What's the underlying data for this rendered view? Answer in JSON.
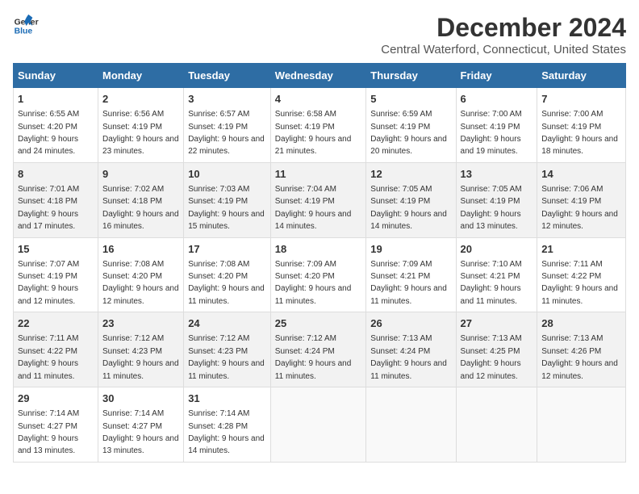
{
  "logo": {
    "line1": "General",
    "line2": "Blue"
  },
  "title": "December 2024",
  "subtitle": "Central Waterford, Connecticut, United States",
  "days_of_week": [
    "Sunday",
    "Monday",
    "Tuesday",
    "Wednesday",
    "Thursday",
    "Friday",
    "Saturday"
  ],
  "weeks": [
    [
      {
        "day": 1,
        "rise": "6:55 AM",
        "set": "4:20 PM",
        "daylight": "9 hours and 24 minutes."
      },
      {
        "day": 2,
        "rise": "6:56 AM",
        "set": "4:19 PM",
        "daylight": "9 hours and 23 minutes."
      },
      {
        "day": 3,
        "rise": "6:57 AM",
        "set": "4:19 PM",
        "daylight": "9 hours and 22 minutes."
      },
      {
        "day": 4,
        "rise": "6:58 AM",
        "set": "4:19 PM",
        "daylight": "9 hours and 21 minutes."
      },
      {
        "day": 5,
        "rise": "6:59 AM",
        "set": "4:19 PM",
        "daylight": "9 hours and 20 minutes."
      },
      {
        "day": 6,
        "rise": "7:00 AM",
        "set": "4:19 PM",
        "daylight": "9 hours and 19 minutes."
      },
      {
        "day": 7,
        "rise": "7:00 AM",
        "set": "4:19 PM",
        "daylight": "9 hours and 18 minutes."
      }
    ],
    [
      {
        "day": 8,
        "rise": "7:01 AM",
        "set": "4:18 PM",
        "daylight": "9 hours and 17 minutes."
      },
      {
        "day": 9,
        "rise": "7:02 AM",
        "set": "4:18 PM",
        "daylight": "9 hours and 16 minutes."
      },
      {
        "day": 10,
        "rise": "7:03 AM",
        "set": "4:19 PM",
        "daylight": "9 hours and 15 minutes."
      },
      {
        "day": 11,
        "rise": "7:04 AM",
        "set": "4:19 PM",
        "daylight": "9 hours and 14 minutes."
      },
      {
        "day": 12,
        "rise": "7:05 AM",
        "set": "4:19 PM",
        "daylight": "9 hours and 14 minutes."
      },
      {
        "day": 13,
        "rise": "7:05 AM",
        "set": "4:19 PM",
        "daylight": "9 hours and 13 minutes."
      },
      {
        "day": 14,
        "rise": "7:06 AM",
        "set": "4:19 PM",
        "daylight": "9 hours and 12 minutes."
      }
    ],
    [
      {
        "day": 15,
        "rise": "7:07 AM",
        "set": "4:19 PM",
        "daylight": "9 hours and 12 minutes."
      },
      {
        "day": 16,
        "rise": "7:08 AM",
        "set": "4:20 PM",
        "daylight": "9 hours and 12 minutes."
      },
      {
        "day": 17,
        "rise": "7:08 AM",
        "set": "4:20 PM",
        "daylight": "9 hours and 11 minutes."
      },
      {
        "day": 18,
        "rise": "7:09 AM",
        "set": "4:20 PM",
        "daylight": "9 hours and 11 minutes."
      },
      {
        "day": 19,
        "rise": "7:09 AM",
        "set": "4:21 PM",
        "daylight": "9 hours and 11 minutes."
      },
      {
        "day": 20,
        "rise": "7:10 AM",
        "set": "4:21 PM",
        "daylight": "9 hours and 11 minutes."
      },
      {
        "day": 21,
        "rise": "7:11 AM",
        "set": "4:22 PM",
        "daylight": "9 hours and 11 minutes."
      }
    ],
    [
      {
        "day": 22,
        "rise": "7:11 AM",
        "set": "4:22 PM",
        "daylight": "9 hours and 11 minutes."
      },
      {
        "day": 23,
        "rise": "7:12 AM",
        "set": "4:23 PM",
        "daylight": "9 hours and 11 minutes."
      },
      {
        "day": 24,
        "rise": "7:12 AM",
        "set": "4:23 PM",
        "daylight": "9 hours and 11 minutes."
      },
      {
        "day": 25,
        "rise": "7:12 AM",
        "set": "4:24 PM",
        "daylight": "9 hours and 11 minutes."
      },
      {
        "day": 26,
        "rise": "7:13 AM",
        "set": "4:24 PM",
        "daylight": "9 hours and 11 minutes."
      },
      {
        "day": 27,
        "rise": "7:13 AM",
        "set": "4:25 PM",
        "daylight": "9 hours and 12 minutes."
      },
      {
        "day": 28,
        "rise": "7:13 AM",
        "set": "4:26 PM",
        "daylight": "9 hours and 12 minutes."
      }
    ],
    [
      {
        "day": 29,
        "rise": "7:14 AM",
        "set": "4:27 PM",
        "daylight": "9 hours and 13 minutes."
      },
      {
        "day": 30,
        "rise": "7:14 AM",
        "set": "4:27 PM",
        "daylight": "9 hours and 13 minutes."
      },
      {
        "day": 31,
        "rise": "7:14 AM",
        "set": "4:28 PM",
        "daylight": "9 hours and 14 minutes."
      },
      null,
      null,
      null,
      null
    ]
  ]
}
